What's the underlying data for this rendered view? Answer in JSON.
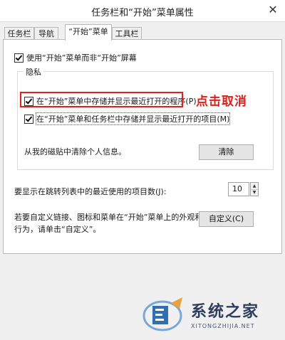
{
  "window": {
    "title": "任务栏和“开始”菜单属性",
    "close_glyph": "✕"
  },
  "tabs": [
    {
      "label": "任务栏"
    },
    {
      "label": "导航"
    },
    {
      "label": "“开始”菜单"
    },
    {
      "label": "工具栏"
    }
  ],
  "start_screen_option": {
    "label": "使用“开始”菜单而非“开始”屏幕",
    "checked": true
  },
  "privacy": {
    "group_label": "隐私",
    "store_recent_programs": {
      "label": "在“开始”菜单中存储并显示最近打开的程序(P)",
      "checked": true
    },
    "store_recent_items": {
      "label": "在“开始”菜单和任务栏中存储并显示最近打开的项目(M)",
      "checked": true
    },
    "clear_text": "从我的磁贴中清除个人信息。",
    "clear_button": "清除"
  },
  "annotation": {
    "text": "点击取消",
    "color": "#e0201b"
  },
  "jump_list": {
    "label": "要显示在跳转列表中的最近使用的项目数(J):",
    "value": "10"
  },
  "customize": {
    "text_line1": "若要自定义链接、图标和菜单在“开始”菜单上的外观和",
    "text_line2": "行为，请单击“自定义”。",
    "button": "自定义(C)"
  },
  "watermark": {
    "brand": "系统之家",
    "url": "XITONGZHIJIA.NET"
  }
}
